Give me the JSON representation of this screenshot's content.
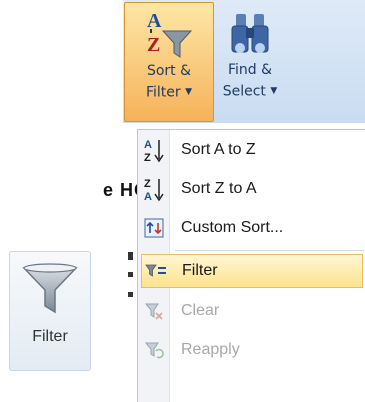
{
  "page_fragment": {
    "text": "e HOME"
  },
  "ribbon": {
    "sort_filter": {
      "line1": "Sort &",
      "line2": "Filter",
      "caret": "▼"
    },
    "find_select": {
      "line1": "Find &",
      "line2": "Select",
      "caret": "▼"
    }
  },
  "menu": {
    "items": [
      {
        "label": "Sort A to Z",
        "accesskey": "S",
        "icon": "sort-a-to-z-icon",
        "enabled": true
      },
      {
        "label": "Sort Z to A",
        "accesskey": "o",
        "icon": "sort-z-to-a-icon",
        "enabled": true
      },
      {
        "label": "Custom Sort...",
        "accesskey": "u",
        "icon": "custom-sort-icon",
        "enabled": true
      },
      {
        "label": "Filter",
        "accesskey": "F",
        "icon": "filter-icon",
        "enabled": true,
        "highlighted": true
      },
      {
        "label": "Clear",
        "accesskey": "C",
        "icon": "clear-filter-icon",
        "enabled": false
      },
      {
        "label": "Reapply",
        "accesskey": "y",
        "icon": "reapply-icon",
        "enabled": false
      }
    ]
  },
  "filter_tile": {
    "label": "Filter",
    "icon": "funnel-icon"
  },
  "colors": {
    "highlight_top": "#fff6d4",
    "highlight_bottom": "#fde38c",
    "active_button": "#f6b25a",
    "ribbon_bg": "#dfeaf7",
    "disabled_text": "#a8a8a8"
  }
}
